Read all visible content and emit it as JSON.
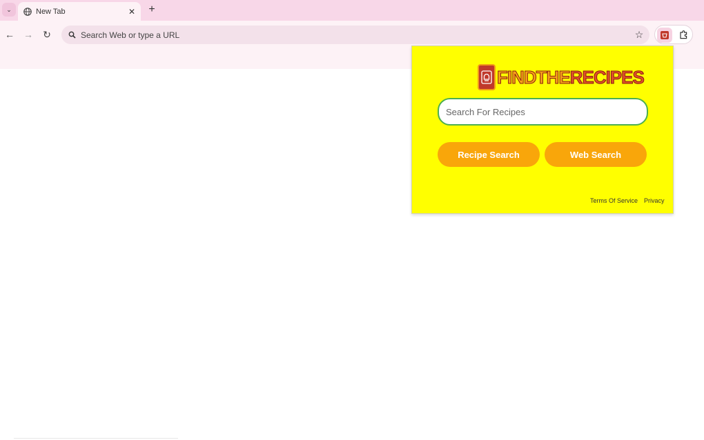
{
  "browser": {
    "tab_list_glyph": "⌄",
    "tab": {
      "title": "New Tab",
      "close_glyph": "✕"
    },
    "new_tab_glyph": "+",
    "nav": {
      "back_glyph": "←",
      "forward_glyph": "→",
      "reload_glyph": "↻"
    },
    "omnibox": {
      "placeholder": "Search Web or type a URL",
      "star_glyph": "☆"
    }
  },
  "popup": {
    "logo": {
      "part1": "FINDTHE",
      "part2": "RECIPES"
    },
    "search_placeholder": "Search For Recipes",
    "buttons": {
      "recipe": "Recipe Search",
      "web": "Web Search"
    },
    "links": {
      "terms": "Terms Of Service",
      "privacy": "Privacy"
    }
  },
  "colors": {
    "tabstrip": "#f8d7e8",
    "toolbar": "#fdf2f6",
    "popup_bg": "#ffff00",
    "button_bg": "#f9a60a",
    "search_border": "#4caf50"
  },
  "icons": [
    "tab-list-icon",
    "globe-icon",
    "close-icon",
    "plus-icon",
    "back-arrow-icon",
    "forward-arrow-icon",
    "reload-icon",
    "search-icon",
    "star-icon",
    "recipe-extension-icon",
    "puzzle-icon",
    "chef-hat-icon"
  ]
}
